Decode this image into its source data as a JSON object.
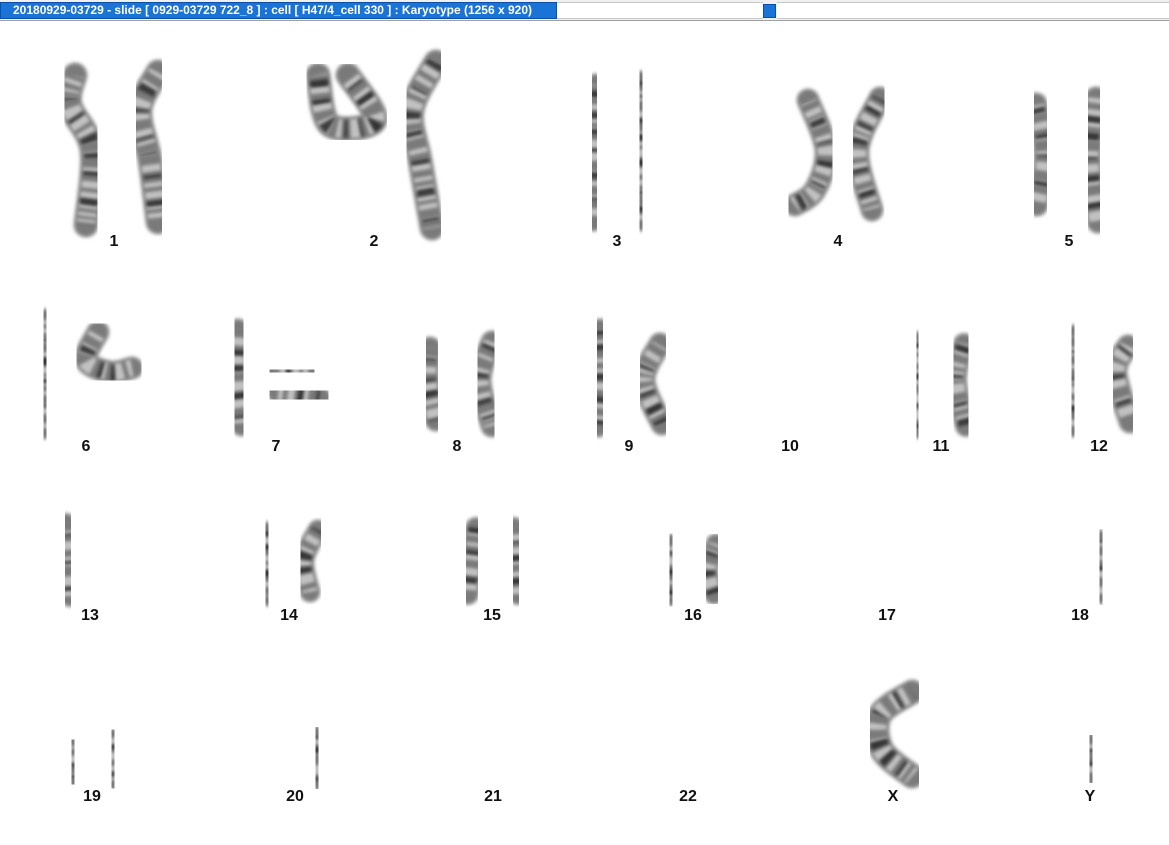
{
  "window": {
    "title": "20180929-03729 - slide [ 0929-03729 722_8 ] : cell [ H47/4_cell 330 ] : Karyotype  (1256 x 920)"
  },
  "colors": {
    "title_accent": "#1a73d6",
    "chromatid_base": "#7a7a7a",
    "band_dark": "#262626",
    "band_light": "#d9d9d9"
  },
  "karyotype": {
    "chromosomes": [
      {
        "label": "1"
      },
      {
        "label": "2"
      },
      {
        "label": "3"
      },
      {
        "label": "4"
      },
      {
        "label": "5"
      },
      {
        "label": "6"
      },
      {
        "label": "7"
      },
      {
        "label": "8"
      },
      {
        "label": "9"
      },
      {
        "label": "10"
      },
      {
        "label": "11"
      },
      {
        "label": "12"
      },
      {
        "label": "13"
      },
      {
        "label": "14"
      },
      {
        "label": "15"
      },
      {
        "label": "16"
      },
      {
        "label": "17"
      },
      {
        "label": "18"
      },
      {
        "label": "19"
      },
      {
        "label": "20"
      },
      {
        "label": "21"
      },
      {
        "label": "22"
      },
      {
        "label": "X"
      },
      {
        "label": "Y"
      }
    ]
  }
}
